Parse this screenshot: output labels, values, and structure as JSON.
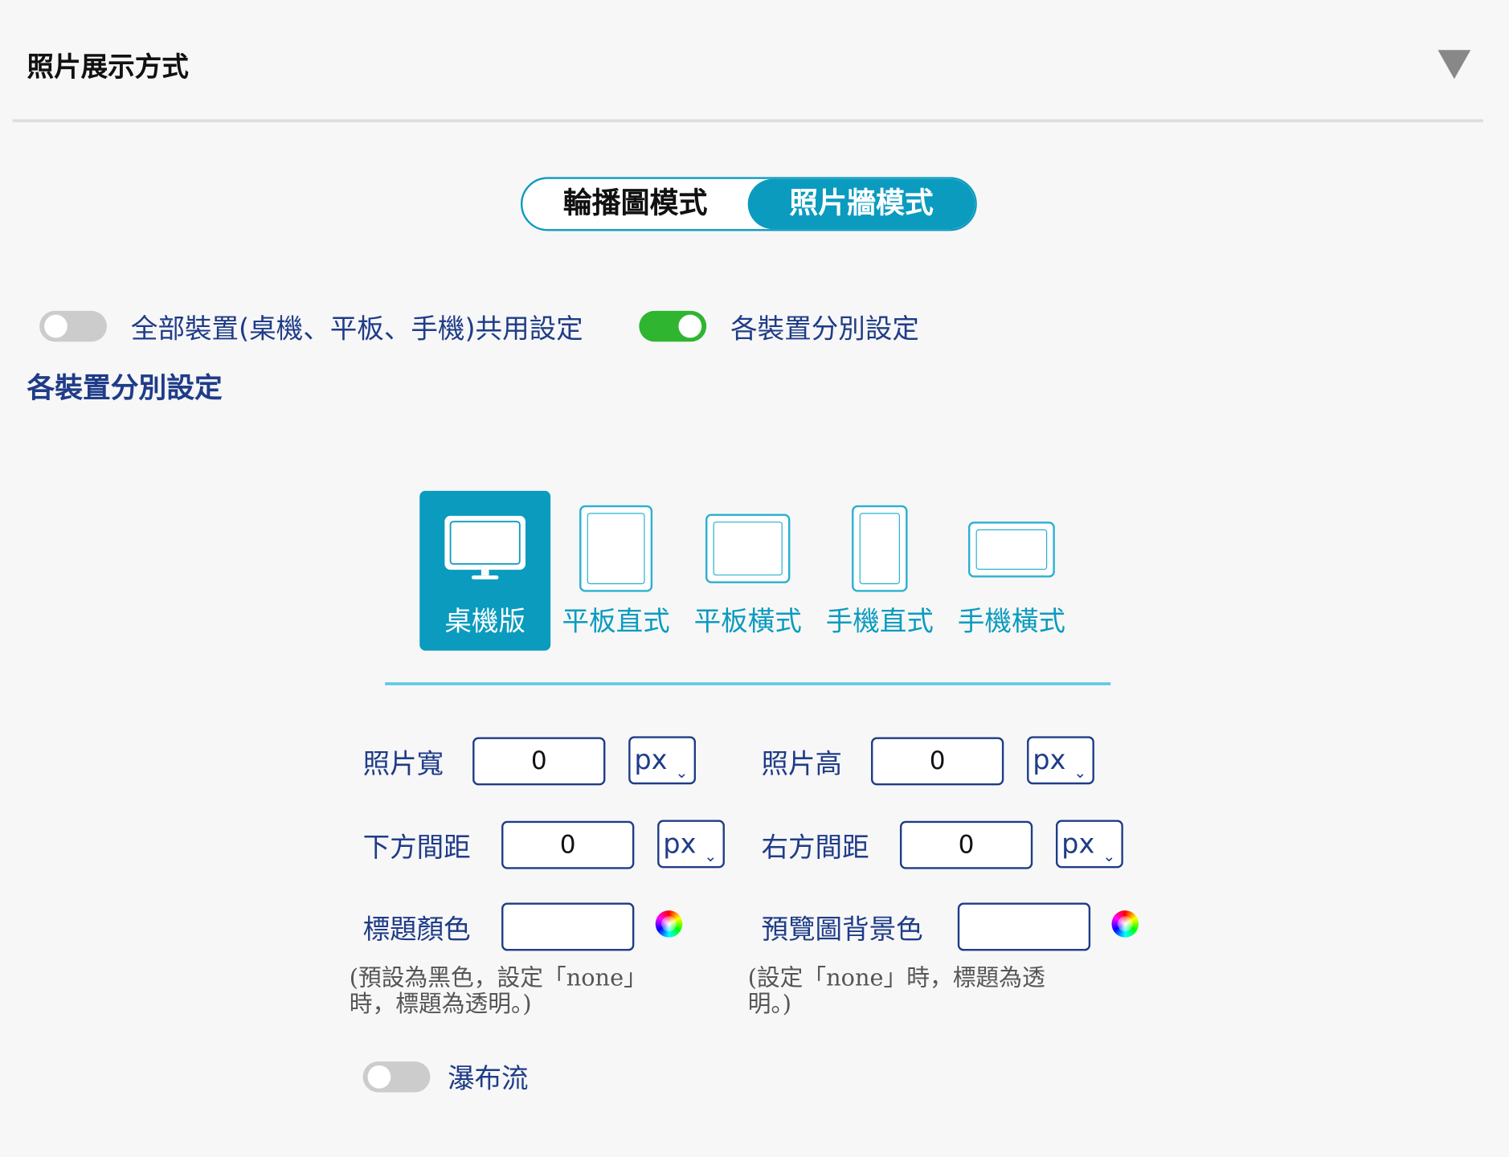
{
  "header": {
    "title": "照片展示方式"
  },
  "mode_switch": {
    "options": [
      "輪播圖模式",
      "照片牆模式"
    ],
    "selected": "照片牆模式"
  },
  "device_toggle": {
    "shared_label": "全部裝置(桌機、平板、手機)共用設定",
    "shared_on": false,
    "separate_label": "各裝置分別設定",
    "separate_on": true
  },
  "section_title": "各裝置分別設定",
  "device_tabs": [
    {
      "label": "桌機版",
      "icon": "desktop-icon",
      "active": true
    },
    {
      "label": "平板直式",
      "icon": "tablet-portrait-icon",
      "active": false
    },
    {
      "label": "平板橫式",
      "icon": "tablet-landscape-icon",
      "active": false
    },
    {
      "label": "手機直式",
      "icon": "phone-portrait-icon",
      "active": false
    },
    {
      "label": "手機橫式",
      "icon": "phone-landscape-icon",
      "active": false
    }
  ],
  "fields": {
    "photo_width": {
      "label": "照片寬",
      "value": "0",
      "unit": "px"
    },
    "photo_height": {
      "label": "照片高",
      "value": "0",
      "unit": "px"
    },
    "bottom_spacing": {
      "label": "下方間距",
      "value": "0",
      "unit": "px"
    },
    "right_spacing": {
      "label": "右方間距",
      "value": "0",
      "unit": "px"
    },
    "title_color": {
      "label": "標題顏色",
      "value": "",
      "note_line1": "(預設為黑色，設定「none」",
      "note_line2": "時，標題為透明。)"
    },
    "preview_bg_color": {
      "label": "預覽圖背景色",
      "value": "",
      "note_line1": "(設定「none」時，標題為透",
      "note_line2": "明。)"
    }
  },
  "masonry": {
    "label": "瀑布流",
    "on": false
  },
  "colors": {
    "accent": "#0a9bbf",
    "label": "#1f3c88",
    "toggle_on": "#2fb52f",
    "toggle_off": "#cccccc"
  }
}
